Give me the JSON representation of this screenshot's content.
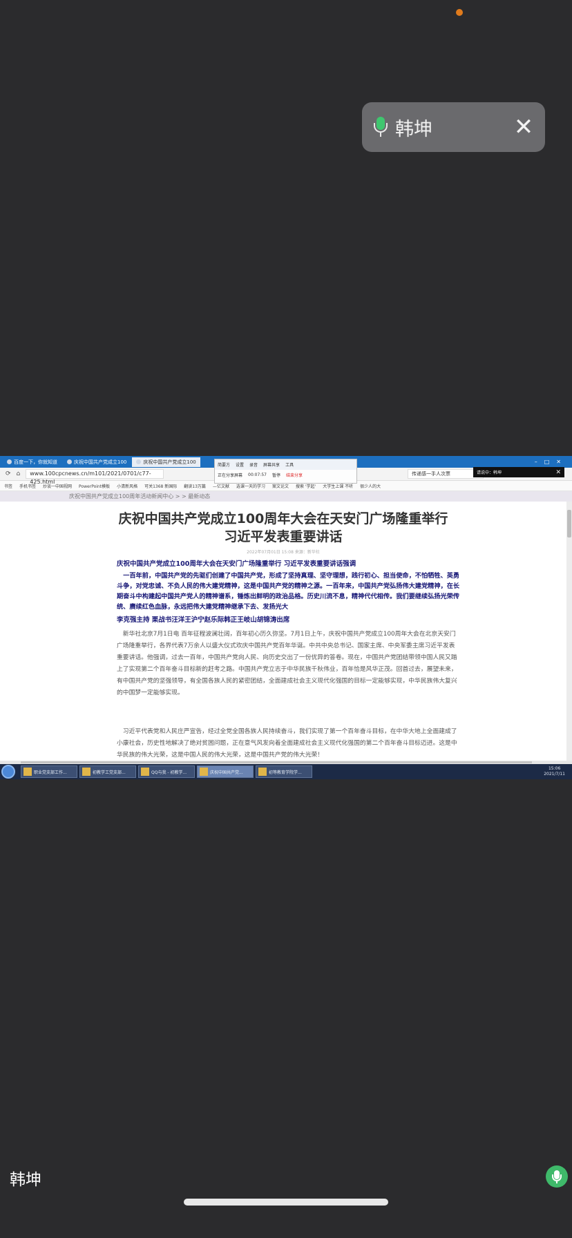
{
  "speaker_popup": {
    "name": "韩坤"
  },
  "shared_screen": {
    "tabs": [
      {
        "label": "百度一下，你就知道"
      },
      {
        "label": "庆祝中国共产党成立100"
      },
      {
        "label": "庆祝中国共产党成立100"
      }
    ],
    "address": {
      "url": "www.100cpcnews.cn/m101/2021/0701/c77-425.html",
      "search": "传递感一手人次票"
    },
    "share_toolbar": {
      "items": [
        "简要方",
        "设置",
        "录音",
        "屏幕共享",
        "工具"
      ],
      "status": "正在分享屏幕",
      "timer": "00:07:57",
      "mute_label": "暂停",
      "stop_label": "结束分享"
    },
    "mini_status": {
      "text": "请说中：韩坤"
    },
    "bookmarks": [
      "书签",
      "手机书签",
      "炒谈一中国视网",
      "PowerPoint模板",
      "小清新风格",
      "可关1368 新国际",
      "翻读13万篇",
      "—亿文献",
      "选课一天的学习",
      "案文论文",
      "搜索 '学起'",
      "大学生上课 不听",
      "很少人的大"
    ],
    "breadcrumb": "庆祝中国共产党成立100周年活动新闻中心 > > 最新动态",
    "article": {
      "title_line1": "庆祝中国共产党成立100周年大会在天安门广场隆重举行",
      "title_line2": "习近平发表重要讲话",
      "meta": "2022年07月01日 15:08    来源：新华社",
      "subtitle": "庆祝中国共产党成立100周年大会在天安门广场隆重举行 习近平发表重要讲话强调",
      "lead": "一百年前，中国共产党的先驱们创建了中国共产党，形成了坚持真理、坚守理想，践行初心、担当使命，不怕牺牲、英勇斗争，对党忠诚、不负人民的伟大建党精神，这是中国共产党的精神之源。一百年来，中国共产党弘扬伟大建党精神，在长期奋斗中构建起中国共产党人的精神谱系，锤炼出鲜明的政治品格。历史川流不息，精神代代相传。我们要继续弘扬光荣传统、赓续红色血脉，永远把伟大建党精神继承下去、发扬光大",
      "host": "李克强主持 栗战书汪洋王沪宁赵乐际韩正王岐山胡锦涛出席",
      "para1": "新华社北京7月1日电 百年征程波澜壮阔，百年初心历久弥坚。7月1日上午，庆祝中国共产党成立100周年大会在北京天安门广场隆重举行，各界代表7万余人以盛大仪式欢庆中国共产党百年华诞。中共中央总书记、国家主席、中央军委主席习近平发表重要讲话。他强调，过去一百年，中国共产党向人民、向历史交出了一份优异的答卷。现在，中国共产党团结带领中国人民又踏上了实现第二个百年奋斗目标新的赶考之路。中国共产党立志于中华民族千秋伟业，百年恰是风华正茂。回首过去，展望未来，有中国共产党的坚强领导，有全国各族人民的紧密团结，全面建成社会主义现代化强国的目标一定能够实现，中华民族伟大复兴的中国梦一定能够实现。",
      "para2": "习近平代表党和人民庄严宣告，经过全党全国各族人民持续奋斗，我们实现了第一个百年奋斗目标，在中华大地上全面建成了小康社会，历史性地解决了绝对贫困问题，正在意气风发向着全面建成社会主义现代化强国的第二个百年奋斗目标迈进。这是中华民族的伟大光荣，这是中国人民的伟大光荣，这是中国共产党的伟大光荣！"
    },
    "taskbar": {
      "items": [
        {
          "label": "职业党支部工作..."
        },
        {
          "label": "初教学工党支部..."
        },
        {
          "label": "QQ与我 - 初教学..."
        },
        {
          "label": "庆祝中国共产党..."
        },
        {
          "label": "初等教育学院学..."
        }
      ],
      "time": "15:06",
      "date": "2021/7/11"
    }
  },
  "bottom_bar": {
    "participant_name": "韩坤"
  },
  "colors": {
    "background": "#2b2b2d",
    "accent_green": "#3fb96a",
    "recording_dot": "#e07b1c",
    "article_heading_blue": "#1a1a78"
  }
}
